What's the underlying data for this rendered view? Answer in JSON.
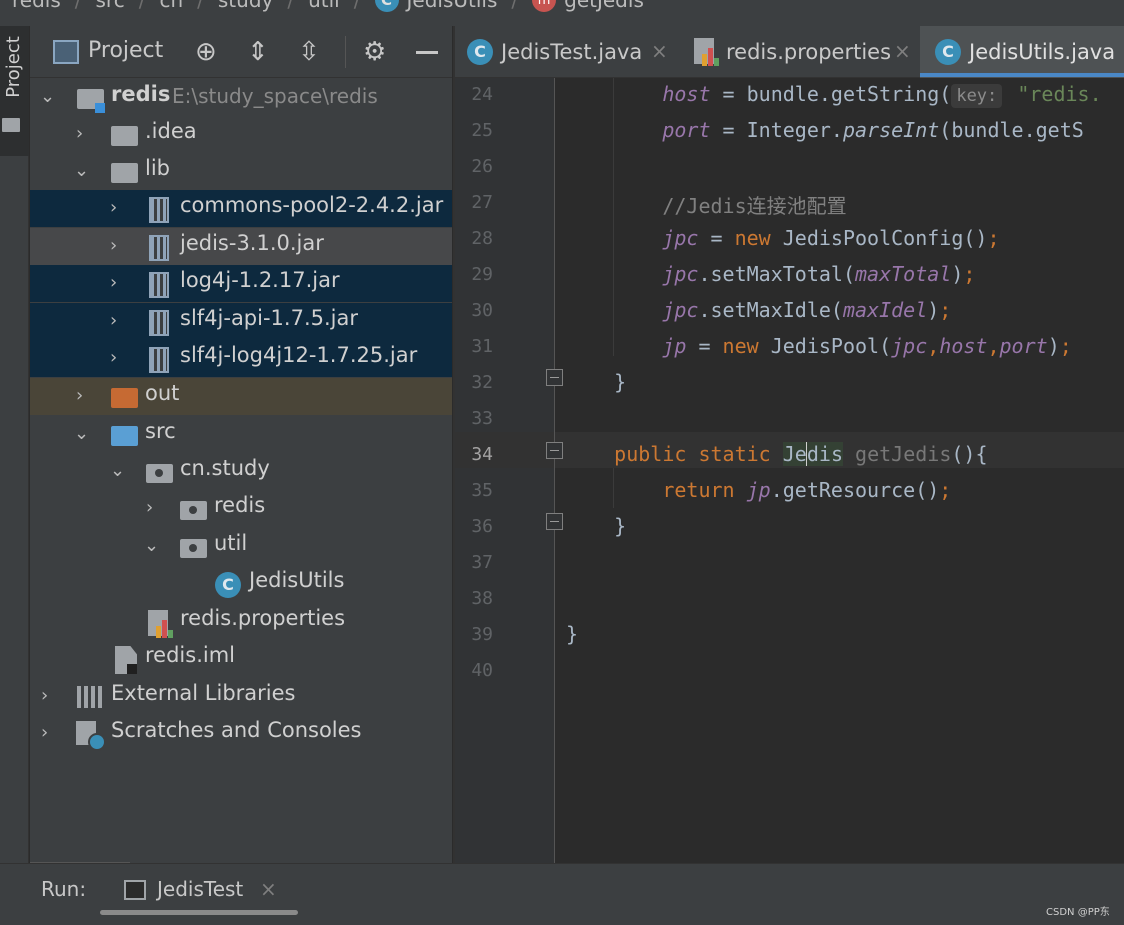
{
  "breadcrumb": {
    "items": [
      "redis",
      "src",
      "cn",
      "study",
      "util",
      "JedisUtils",
      "getJedis"
    ],
    "class_icon_letter": "C",
    "method_icon_letter": "m"
  },
  "side_strip": {
    "label": "Project"
  },
  "project_panel": {
    "title": "Project",
    "toolbar_icons": [
      "target-icon",
      "expand-all-icon",
      "collapse-all-icon",
      "gear-icon",
      "minimize-icon"
    ],
    "tree": [
      {
        "label": "redis",
        "path": "E:\\study_space\\redis",
        "icon": "module-folder-icon",
        "expanded": true
      },
      {
        "label": ".idea",
        "icon": "folder-icon",
        "expanded": false
      },
      {
        "label": "lib",
        "icon": "folder-icon",
        "expanded": true
      },
      {
        "label": "commons-pool2-2.4.2.jar",
        "icon": "jar-icon",
        "selected": true
      },
      {
        "label": "jedis-3.1.0.jar",
        "icon": "jar-icon",
        "focused": true
      },
      {
        "label": "log4j-1.2.17.jar",
        "icon": "jar-icon",
        "selected": true
      },
      {
        "label": "slf4j-api-1.7.5.jar",
        "icon": "jar-icon",
        "selected": true
      },
      {
        "label": "slf4j-log4j12-1.7.25.jar",
        "icon": "jar-icon",
        "selected": true
      },
      {
        "label": "out",
        "icon": "excluded-folder-icon",
        "expanded": false
      },
      {
        "label": "src",
        "icon": "source-folder-icon",
        "expanded": true
      },
      {
        "label": "cn.study",
        "icon": "package-icon",
        "expanded": true
      },
      {
        "label": "redis",
        "icon": "package-icon",
        "expanded": false
      },
      {
        "label": "util",
        "icon": "package-icon",
        "expanded": true
      },
      {
        "label": "JedisUtils",
        "icon": "class-icon"
      },
      {
        "label": "redis.properties",
        "icon": "properties-file-icon"
      },
      {
        "label": "redis.iml",
        "icon": "iml-file-icon"
      },
      {
        "label": "External Libraries",
        "icon": "libraries-icon"
      },
      {
        "label": "Scratches and Consoles",
        "icon": "scratches-icon"
      }
    ]
  },
  "editor_tabs": [
    {
      "label": "JedisTest.java",
      "icon": "java-test-class-icon",
      "active": false
    },
    {
      "label": "redis.properties",
      "icon": "properties-file-icon",
      "active": false
    },
    {
      "label": "JedisUtils.java",
      "icon": "class-icon",
      "active": true
    }
  ],
  "editor": {
    "current_line": "34",
    "lines": [
      {
        "num": "24",
        "segs": [
          {
            "t": "        "
          },
          {
            "t": "host",
            "c": "fi"
          },
          {
            "t": " = bundle.getString("
          },
          {
            "t": "key:",
            "c": "hint"
          },
          {
            "t": " "
          },
          {
            "t": "\"redis.",
            "c": "st"
          }
        ]
      },
      {
        "num": "25",
        "segs": [
          {
            "t": "        "
          },
          {
            "t": "port",
            "c": "fi"
          },
          {
            "t": " = Integer."
          },
          {
            "t": "parseInt",
            "c": "mt"
          },
          {
            "t": "(bundle.getS"
          }
        ]
      },
      {
        "num": "26",
        "segs": []
      },
      {
        "num": "27",
        "segs": [
          {
            "t": "        "
          },
          {
            "t": "//Jedis连接池配置",
            "c": "cm"
          }
        ]
      },
      {
        "num": "28",
        "segs": [
          {
            "t": "        "
          },
          {
            "t": "jpc",
            "c": "fi"
          },
          {
            "t": " = "
          },
          {
            "t": "new",
            "c": "kw"
          },
          {
            "t": " JedisPoolConfig()"
          },
          {
            "t": ";",
            "c": "kw"
          }
        ]
      },
      {
        "num": "29",
        "segs": [
          {
            "t": "        "
          },
          {
            "t": "jpc",
            "c": "fi"
          },
          {
            "t": ".setMaxTotal("
          },
          {
            "t": "maxTotal",
            "c": "fi"
          },
          {
            "t": ")"
          },
          {
            "t": ";",
            "c": "kw"
          }
        ]
      },
      {
        "num": "30",
        "segs": [
          {
            "t": "        "
          },
          {
            "t": "jpc",
            "c": "fi"
          },
          {
            "t": ".setMaxIdle("
          },
          {
            "t": "maxIdel",
            "c": "fi"
          },
          {
            "t": ")"
          },
          {
            "t": ";",
            "c": "kw"
          }
        ]
      },
      {
        "num": "31",
        "segs": [
          {
            "t": "        "
          },
          {
            "t": "jp",
            "c": "fi"
          },
          {
            "t": " = "
          },
          {
            "t": "new",
            "c": "kw"
          },
          {
            "t": " JedisPool("
          },
          {
            "t": "jpc",
            "c": "fi"
          },
          {
            "t": ",",
            "c": "kw"
          },
          {
            "t": "host",
            "c": "fi"
          },
          {
            "t": ",",
            "c": "kw"
          },
          {
            "t": "port",
            "c": "fi"
          },
          {
            "t": ")"
          },
          {
            "t": ";",
            "c": "kw"
          }
        ]
      },
      {
        "num": "32",
        "segs": [
          {
            "t": "    }"
          }
        ]
      },
      {
        "num": "33",
        "segs": []
      },
      {
        "num": "34",
        "segs": [
          {
            "t": "    "
          },
          {
            "t": "public",
            "c": "kw"
          },
          {
            "t": " "
          },
          {
            "t": "static",
            "c": "kw"
          },
          {
            "t": " "
          },
          {
            "t": "Je",
            "c": "hl"
          },
          {
            "t": "",
            "c": "caret"
          },
          {
            "t": "dis",
            "c": "hl"
          },
          {
            "t": " "
          },
          {
            "t": "getJedis",
            "c": "gr"
          },
          {
            "t": "(){"
          }
        ]
      },
      {
        "num": "35",
        "segs": [
          {
            "t": "        "
          },
          {
            "t": "return",
            "c": "kw"
          },
          {
            "t": " "
          },
          {
            "t": "jp",
            "c": "fi"
          },
          {
            "t": ".getResource()"
          },
          {
            "t": ";",
            "c": "kw"
          }
        ]
      },
      {
        "num": "36",
        "segs": [
          {
            "t": "    }"
          }
        ]
      },
      {
        "num": "37",
        "segs": []
      },
      {
        "num": "38",
        "segs": []
      },
      {
        "num": "39",
        "segs": [
          {
            "t": "}"
          }
        ]
      },
      {
        "num": "40",
        "segs": []
      }
    ]
  },
  "run_bar": {
    "label": "Run:",
    "tab_label": "JedisTest",
    "close_glyph": "×"
  },
  "watermark": "CSDN @PP东",
  "colors": {
    "keyword": "#cc7832",
    "field": "#9876aa",
    "comment": "#808080",
    "string": "#6a8759",
    "plain_text": "#a9b7c6",
    "selection": "#0d293e",
    "active_tab_underline": "#4a88c7"
  }
}
